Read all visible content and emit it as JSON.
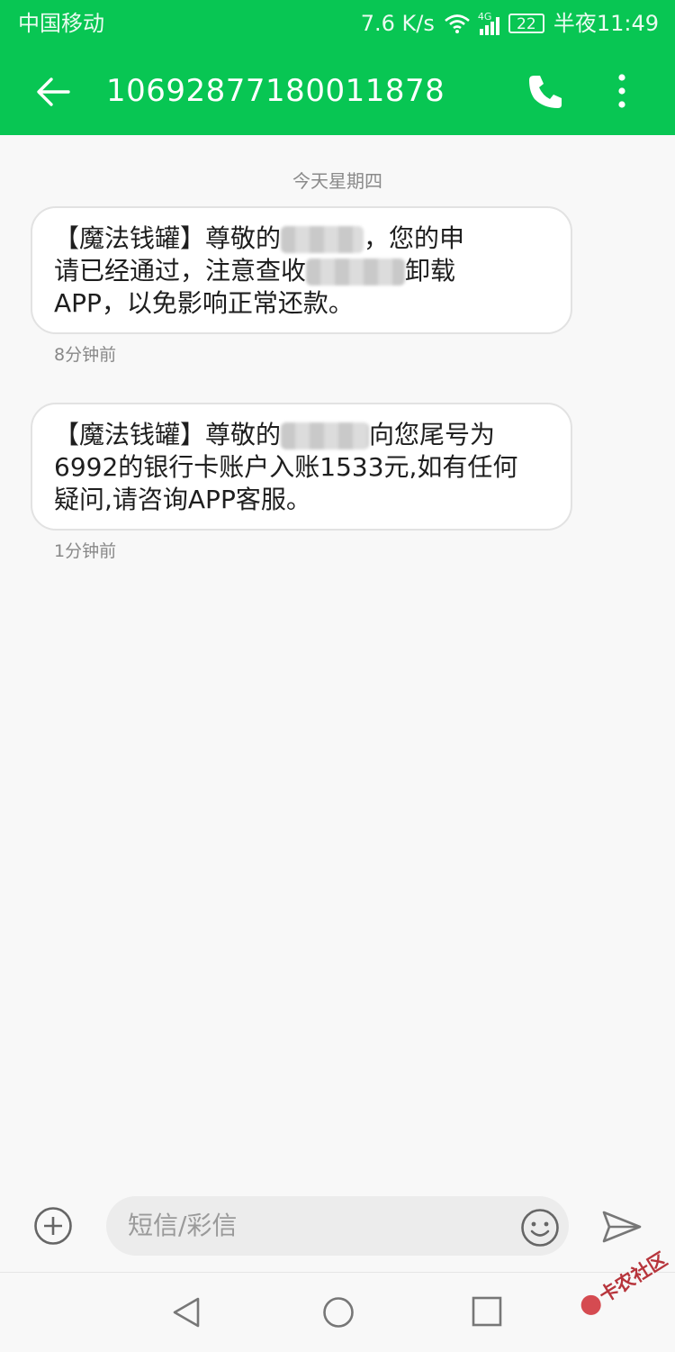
{
  "status_bar": {
    "carrier": "中国移动",
    "speed": "7.6 K/s",
    "network": "4G",
    "battery": "22",
    "time": "半夜11:49"
  },
  "header": {
    "title": "10692877180011878",
    "back_icon": "back-arrow-icon",
    "call_icon": "phone-icon",
    "more_icon": "more-vertical-icon"
  },
  "conversation": {
    "date_separator": "今天星期四",
    "messages": [
      {
        "line1_pre": "【魔法钱罐】尊敬的",
        "line1_post": "，您的申",
        "line2_pre": "请已经通过，注意查收",
        "line2_post": "卸载",
        "line3": "APP，以免影响正常还款。",
        "time": "8分钟前"
      },
      {
        "line1_pre": "【魔法钱罐】尊敬的",
        "line1_post": "向您尾号为",
        "line2": "6992的银行卡账户入账1533元,如有任何",
        "line3": "疑问,请咨询APP客服。",
        "time": "1分钟前"
      }
    ]
  },
  "input_bar": {
    "placeholder": "短信/彩信",
    "add_icon": "add-circle-icon",
    "emoji_icon": "emoji-icon",
    "send_icon": "send-icon"
  },
  "nav_bar": {
    "back_icon": "nav-back-icon",
    "home_icon": "nav-home-icon",
    "recent_icon": "nav-recent-icon"
  },
  "watermark": {
    "text": "卡农社区"
  },
  "colors": {
    "accent": "#08c653",
    "background": "#f8f8f8",
    "bubble": "#ffffff"
  }
}
